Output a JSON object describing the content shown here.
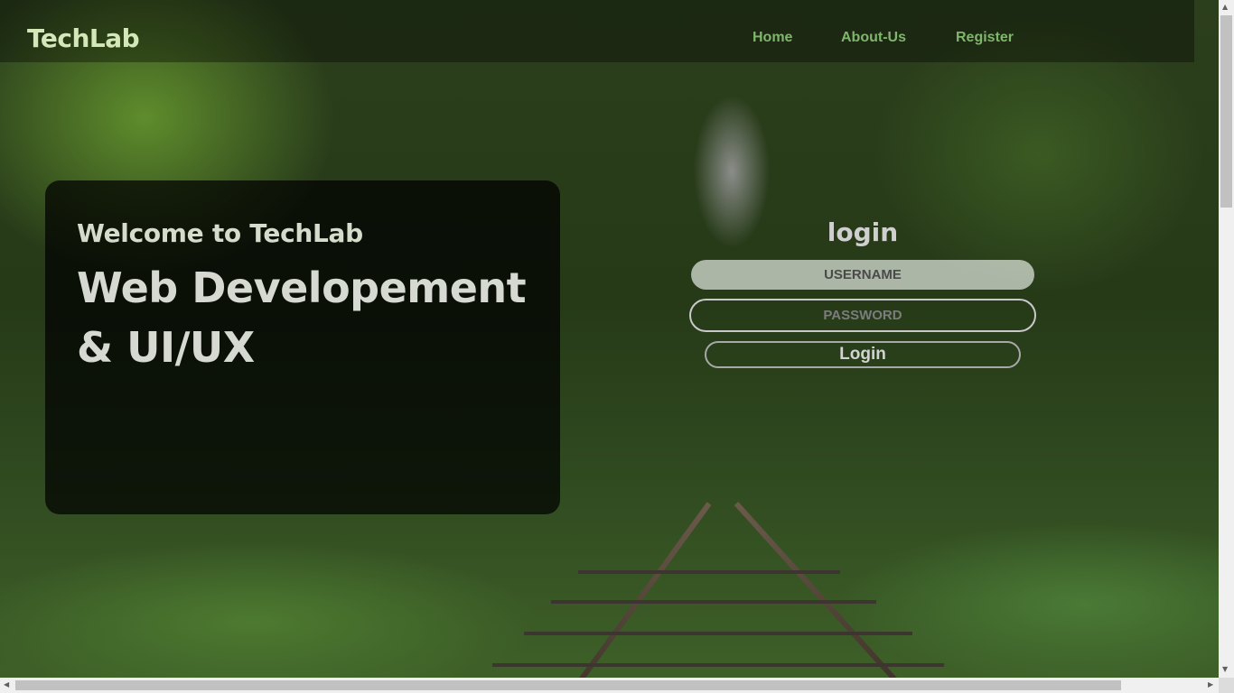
{
  "brand": "TechLab",
  "nav": {
    "items": [
      {
        "label": "Home"
      },
      {
        "label": "About-Us"
      },
      {
        "label": "Register"
      }
    ]
  },
  "welcome": {
    "greeting": "Welcome to TechLab",
    "headline": "Web Developement & UI/UX"
  },
  "login": {
    "title": "login",
    "username_placeholder": "USERNAME",
    "password_placeholder": "PASSWORD",
    "button_label": "Login"
  },
  "colors": {
    "brand": "#d4e7b8",
    "nav_link": "#7fb56c",
    "panel": "rgba(0,0,0,0.72)"
  },
  "icons": [
    "scroll-up-arrow-icon",
    "scroll-down-arrow-icon",
    "scroll-left-arrow-icon",
    "scroll-right-arrow-icon"
  ]
}
